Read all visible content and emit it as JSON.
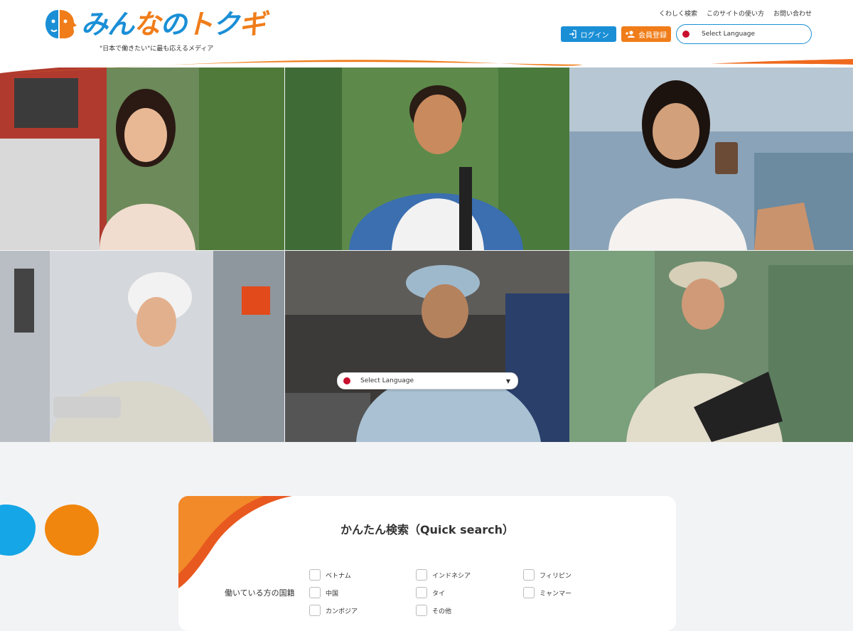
{
  "header": {
    "logo_text": "みんなのトクギ",
    "tagline": "\"日本で働きたい\"に最も応えるメディア",
    "links": [
      "くわしく検索",
      "このサイトの使い方",
      "お問い合わせ"
    ],
    "login_label": "ログイン",
    "register_label": "会員登録",
    "language_select": "Select Language"
  },
  "hero": {
    "language_select": "Select Language",
    "colors": {
      "blue": "#1a8fd6",
      "orange": "#f07d1a"
    }
  },
  "quick_search": {
    "title": "かんたん検索（Quick search）",
    "nationality_label": "働いている方の国籍",
    "options": [
      "ベトナム",
      "インドネシア",
      "フィリピン",
      "中国",
      "タイ",
      "ミャンマー",
      "カンボジア",
      "その他"
    ]
  }
}
